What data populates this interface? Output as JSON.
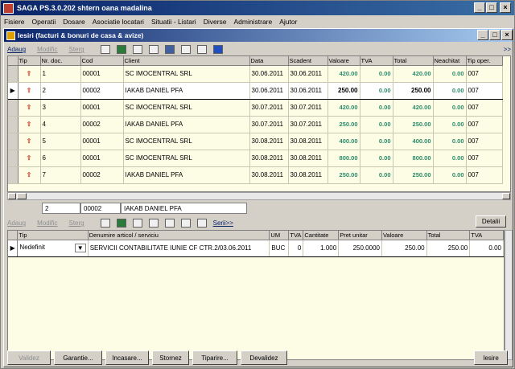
{
  "title": "SAGA PS.3.0.202     shtern oana madalina",
  "menu": [
    "Fisiere",
    "Operatii",
    "Dosare",
    "Asociatie locatari",
    "Situatii - Listari",
    "Diverse",
    "Administrare",
    "Ajutor"
  ],
  "child_title": "Iesiri (facturi & bonuri de casa & avize)",
  "toolbar": {
    "adaug": "Adaug",
    "modific": "Modific",
    "sterg": "Sterg",
    "more": ">>"
  },
  "top_grid": {
    "headers": [
      "Tip",
      "Nr. doc.",
      "Cod",
      "Client",
      "Data",
      "Scadent",
      "Valoare",
      "TVA",
      "Total",
      "Neachitat",
      "Tip oper."
    ],
    "rows": [
      {
        "nr": "1",
        "cod": "00001",
        "client": "SC IMOCENTRAL SRL",
        "data": "30.06.2011",
        "scadent": "30.06.2011",
        "valoare": "420.00",
        "tva": "0.00",
        "total": "420.00",
        "neachitat": "0.00",
        "tip": "007"
      },
      {
        "nr": "2",
        "cod": "00002",
        "client": "IAKAB DANIEL PFA",
        "data": "30.06.2011",
        "scadent": "30.06.2011",
        "valoare": "250.00",
        "tva": "0.00",
        "total": "250.00",
        "neachitat": "0.00",
        "tip": "007"
      },
      {
        "nr": "3",
        "cod": "00001",
        "client": "SC IMOCENTRAL SRL",
        "data": "30.07.2011",
        "scadent": "30.07.2011",
        "valoare": "420.00",
        "tva": "0.00",
        "total": "420.00",
        "neachitat": "0.00",
        "tip": "007"
      },
      {
        "nr": "4",
        "cod": "00002",
        "client": "IAKAB DANIEL PFA",
        "data": "30.07.2011",
        "scadent": "30.07.2011",
        "valoare": "250.00",
        "tva": "0.00",
        "total": "250.00",
        "neachitat": "0.00",
        "tip": "007"
      },
      {
        "nr": "5",
        "cod": "00001",
        "client": "SC IMOCENTRAL SRL",
        "data": "30.08.2011",
        "scadent": "30.08.2011",
        "valoare": "400.00",
        "tva": "0.00",
        "total": "400.00",
        "neachitat": "0.00",
        "tip": "007"
      },
      {
        "nr": "6",
        "cod": "00001",
        "client": "SC IMOCENTRAL SRL",
        "data": "30.08.2011",
        "scadent": "30.08.2011",
        "valoare": "800.00",
        "tva": "0.00",
        "total": "800.00",
        "neachitat": "0.00",
        "tip": "007"
      },
      {
        "nr": "7",
        "cod": "00002",
        "client": "IAKAB DANIEL PFA",
        "data": "30.08.2011",
        "scadent": "30.08.2011",
        "valoare": "250.00",
        "tva": "0.00",
        "total": "250.00",
        "neachitat": "0.00",
        "tip": "007"
      }
    ]
  },
  "info": {
    "nr": "2",
    "cod": "00002",
    "client": "IAKAB DANIEL PFA"
  },
  "toolbar2": {
    "adaug": "Adaug",
    "modific": "Modific",
    "sterg": "Sterg",
    "serii": "Serii>>",
    "detalii": "Detalii"
  },
  "bottom_grid": {
    "headers": [
      "Tip",
      "Denumire articol / serviciu",
      "UM",
      "TVA",
      "Cantitate",
      "Pret unitar",
      "Valoare",
      "Total",
      "TVA"
    ],
    "row": {
      "tip": "Nedefinit",
      "den": "SERVICII CONTABILITATE IUNIE CF CTR.2/03.06.2011",
      "um": "BUC",
      "tva": "0",
      "cant": "1.000",
      "pret": "250.0000",
      "valoare": "250.00",
      "total": "250.00",
      "tva2": "0.00"
    }
  },
  "buttons": {
    "valideaz": "Validez",
    "garantie": "Garantie...",
    "incasare": "Incasare...",
    "stornez": "Stornez",
    "tiparire": "Tiparire...",
    "devalidez": "Devalidez",
    "iesire": "Iesire"
  }
}
